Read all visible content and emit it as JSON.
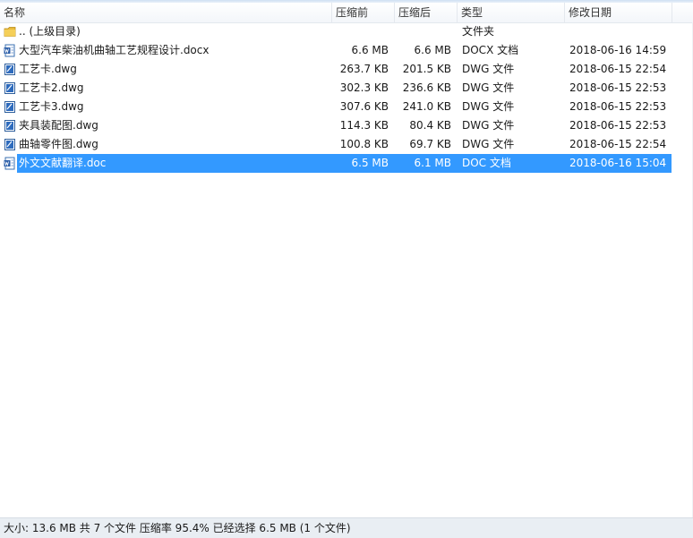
{
  "columns": {
    "name": "名称",
    "packed": "压缩前",
    "compressed": "压缩后",
    "type": "类型",
    "modified": "修改日期"
  },
  "rows": [
    {
      "name": ".. (上级目录)",
      "packed": "",
      "compressed": "",
      "type": "文件夹",
      "modified": "",
      "icon": "folder-icon"
    },
    {
      "name": "大型汽车柴油机曲轴工艺规程设计.docx",
      "packed": "6.6 MB",
      "compressed": "6.6 MB",
      "type": "DOCX 文档",
      "modified": "2018-06-16 14:59",
      "icon": "word-document-icon"
    },
    {
      "name": "工艺卡.dwg",
      "packed": "263.7 KB",
      "compressed": "201.5 KB",
      "type": "DWG 文件",
      "modified": "2018-06-15 22:54",
      "icon": "dwg-file-icon"
    },
    {
      "name": "工艺卡2.dwg",
      "packed": "302.3 KB",
      "compressed": "236.6 KB",
      "type": "DWG 文件",
      "modified": "2018-06-15 22:53",
      "icon": "dwg-file-icon"
    },
    {
      "name": "工艺卡3.dwg",
      "packed": "307.6 KB",
      "compressed": "241.0 KB",
      "type": "DWG 文件",
      "modified": "2018-06-15 22:53",
      "icon": "dwg-file-icon"
    },
    {
      "name": "夹具装配图.dwg",
      "packed": "114.3 KB",
      "compressed": "80.4 KB",
      "type": "DWG 文件",
      "modified": "2018-06-15 22:53",
      "icon": "dwg-file-icon"
    },
    {
      "name": "曲轴零件图.dwg",
      "packed": "100.8 KB",
      "compressed": "69.7 KB",
      "type": "DWG 文件",
      "modified": "2018-06-15 22:54",
      "icon": "dwg-file-icon"
    },
    {
      "name": "外文文献翻译.doc",
      "packed": "6.5 MB",
      "compressed": "6.1 MB",
      "type": "DOC 文档",
      "modified": "2018-06-16 15:04",
      "icon": "word-document-icon",
      "selected": true
    }
  ],
  "status": "大小: 13.6 MB 共 7 个文件 压缩率 95.4% 已经选择 6.5 MB (1 个文件)",
  "colors": {
    "selection": "#3399ff",
    "status_bg": "#e9eef3"
  }
}
